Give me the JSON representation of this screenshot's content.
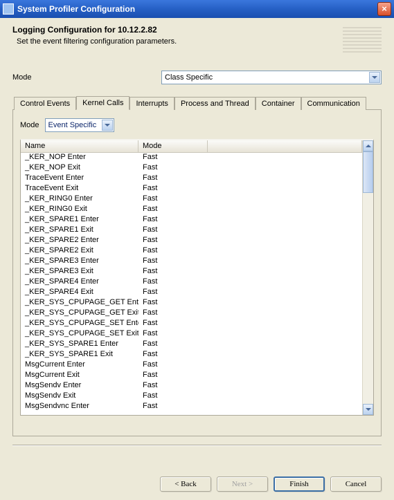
{
  "title": "System Profiler Configuration",
  "header": {
    "title": "Logging Configuration for 10.12.2.82",
    "subtitle": "Set the event filtering configuration parameters."
  },
  "mode_row": {
    "label": "Mode",
    "value": "Class Specific"
  },
  "tabs": [
    "Control Events",
    "Kernel Calls",
    "Interrupts",
    "Process and Thread",
    "Container",
    "Communication"
  ],
  "active_tab": "Kernel Calls",
  "inner_mode": {
    "label": "Mode",
    "value": "Event Specific"
  },
  "columns": {
    "name": "Name",
    "mode": "Mode"
  },
  "rows": [
    {
      "name": "_KER_NOP Enter",
      "mode": "Fast"
    },
    {
      "name": "_KER_NOP Exit",
      "mode": "Fast"
    },
    {
      "name": "TraceEvent Enter",
      "mode": "Fast"
    },
    {
      "name": "TraceEvent Exit",
      "mode": "Fast"
    },
    {
      "name": "_KER_RING0 Enter",
      "mode": "Fast"
    },
    {
      "name": "_KER_RING0 Exit",
      "mode": "Fast"
    },
    {
      "name": "_KER_SPARE1 Enter",
      "mode": "Fast"
    },
    {
      "name": "_KER_SPARE1 Exit",
      "mode": "Fast"
    },
    {
      "name": "_KER_SPARE2 Enter",
      "mode": "Fast"
    },
    {
      "name": "_KER_SPARE2 Exit",
      "mode": "Fast"
    },
    {
      "name": "_KER_SPARE3 Enter",
      "mode": "Fast"
    },
    {
      "name": "_KER_SPARE3 Exit",
      "mode": "Fast"
    },
    {
      "name": "_KER_SPARE4 Enter",
      "mode": "Fast"
    },
    {
      "name": "_KER_SPARE4 Exit",
      "mode": "Fast"
    },
    {
      "name": "_KER_SYS_CPUPAGE_GET Enter",
      "mode": "Fast"
    },
    {
      "name": "_KER_SYS_CPUPAGE_GET Exit",
      "mode": "Fast"
    },
    {
      "name": "_KER_SYS_CPUPAGE_SET Enter",
      "mode": "Fast"
    },
    {
      "name": "_KER_SYS_CPUPAGE_SET Exit",
      "mode": "Fast"
    },
    {
      "name": "_KER_SYS_SPARE1 Enter",
      "mode": "Fast"
    },
    {
      "name": "_KER_SYS_SPARE1 Exit",
      "mode": "Fast"
    },
    {
      "name": "MsgCurrent Enter",
      "mode": "Fast"
    },
    {
      "name": "MsgCurrent Exit",
      "mode": "Fast"
    },
    {
      "name": "MsgSendv Enter",
      "mode": "Fast"
    },
    {
      "name": "MsgSendv Exit",
      "mode": "Fast"
    },
    {
      "name": "MsgSendvnc Enter",
      "mode": "Fast"
    }
  ],
  "buttons": {
    "back": "< Back",
    "next": "Next >",
    "finish": "Finish",
    "cancel": "Cancel"
  }
}
